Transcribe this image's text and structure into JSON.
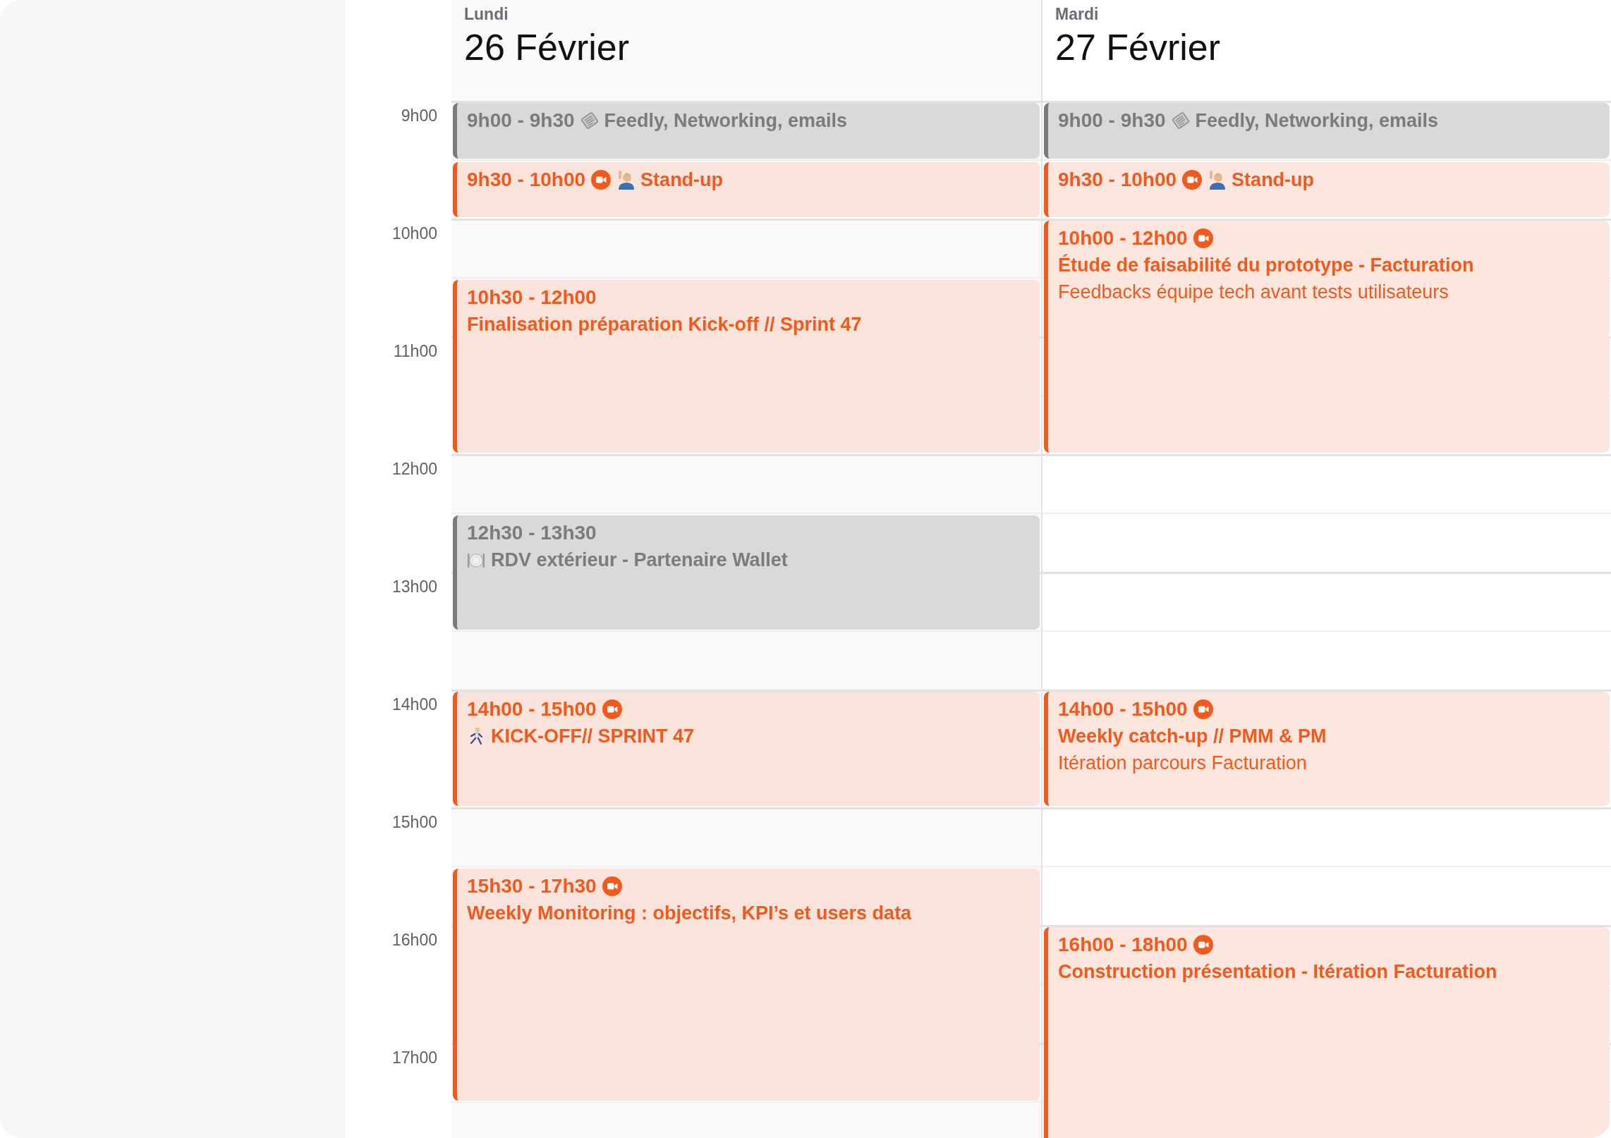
{
  "hours": [
    "9h00",
    "10h00",
    "11h00",
    "12h00",
    "13h00",
    "14h00",
    "15h00",
    "16h00",
    "17h00"
  ],
  "days": [
    {
      "weekday": "Lundi",
      "date": "26 Février",
      "color": "#f9f9f9",
      "events": [
        {
          "kind": "news",
          "time": "9h00 - 9h30",
          "video": false,
          "title": "Feedly, Networking, emails"
        },
        {
          "kind": "standup",
          "time": "9h30 - 10h00",
          "video": true,
          "title": "Stand-up"
        },
        {
          "kind": "meeting",
          "time": "10h30 - 12h00",
          "video": false,
          "title": "Finalisation préparation Kick-off // Sprint 47"
        },
        {
          "kind": "lunch",
          "time": "12h30 - 13h30",
          "video": false,
          "title": "RDV extérieur - Partenaire Wallet"
        },
        {
          "kind": "kickoff",
          "time": "14h00 - 15h00",
          "video": true,
          "title": "KICK-OFF// SPRINT 47"
        },
        {
          "kind": "meeting",
          "time": "15h30 - 17h30",
          "video": true,
          "title": "Weekly Monitoring : objectifs, KPI’s et users data"
        }
      ]
    },
    {
      "weekday": "Mardi",
      "date": "27 Février",
      "color": "#ffffff",
      "events": [
        {
          "kind": "news",
          "time": "9h00 - 9h30",
          "video": false,
          "title": "Feedly, Networking, emails"
        },
        {
          "kind": "standup",
          "time": "9h30 - 10h00",
          "video": true,
          "title": "Stand-up"
        },
        {
          "kind": "meeting",
          "time": "10h00 - 12h00",
          "video": true,
          "title": "Étude de faisabilité du prototype - Facturation",
          "subtitle": "Feedbacks équipe tech avant tests utilisateurs"
        },
        {
          "kind": "meeting",
          "time": "14h00 - 15h00",
          "video": true,
          "title": "Weekly catch-up // PMM & PM",
          "subtitle": "Itération parcours Facturation"
        },
        {
          "kind": "meeting",
          "time": "16h00 - 18h00",
          "video": true,
          "title": "Construction présentation - Itération Facturation"
        }
      ]
    }
  ]
}
